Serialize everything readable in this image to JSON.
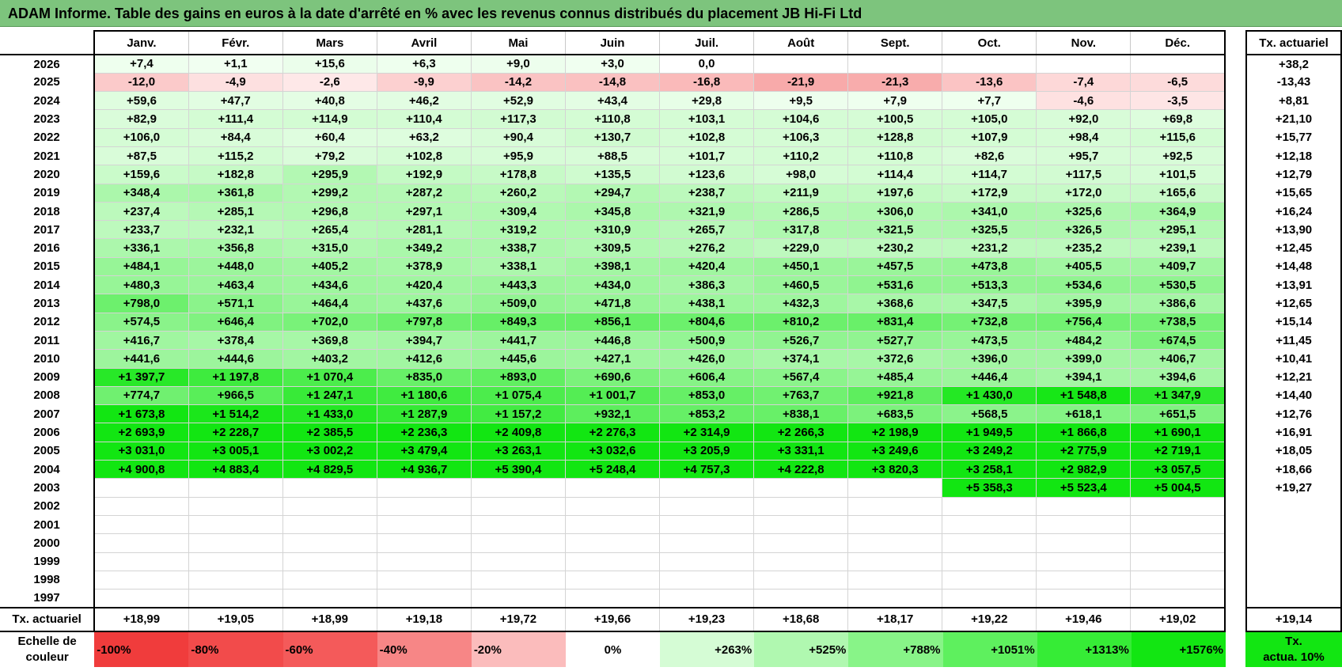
{
  "title": "ADAM Informe. Table des gains en euros à la date d'arrêté en % avec les revenus connus distribués du placement JB Hi-Fi Ltd",
  "months": [
    "Janv.",
    "Févr.",
    "Mars",
    "Avril",
    "Mai",
    "Juin",
    "Juil.",
    "Août",
    "Sept.",
    "Oct.",
    "Nov.",
    "Déc."
  ],
  "side_header": "Tx. actuariel",
  "rows": [
    {
      "year": "2026",
      "values": [
        "+7,4",
        "+1,1",
        "+15,6",
        "+6,3",
        "+9,0",
        "+3,0",
        "0,0",
        "",
        "",
        "",
        "",
        ""
      ],
      "rate": "+38,2"
    },
    {
      "year": "2025",
      "values": [
        "-12,0",
        "-4,9",
        "-2,6",
        "-9,9",
        "-14,2",
        "-14,8",
        "-16,8",
        "-21,9",
        "-21,3",
        "-13,6",
        "-7,4",
        "-6,5"
      ],
      "rate": "-13,43"
    },
    {
      "year": "2024",
      "values": [
        "+59,6",
        "+47,7",
        "+40,8",
        "+46,2",
        "+52,9",
        "+43,4",
        "+29,8",
        "+9,5",
        "+7,9",
        "+7,7",
        "-4,6",
        "-3,5"
      ],
      "rate": "+8,81"
    },
    {
      "year": "2023",
      "values": [
        "+82,9",
        "+111,4",
        "+114,9",
        "+110,4",
        "+117,3",
        "+110,8",
        "+103,1",
        "+104,6",
        "+100,5",
        "+105,0",
        "+92,0",
        "+69,8"
      ],
      "rate": "+21,10"
    },
    {
      "year": "2022",
      "values": [
        "+106,0",
        "+84,4",
        "+60,4",
        "+63,2",
        "+90,4",
        "+130,7",
        "+102,8",
        "+106,3",
        "+128,8",
        "+107,9",
        "+98,4",
        "+115,6"
      ],
      "rate": "+15,77"
    },
    {
      "year": "2021",
      "values": [
        "+87,5",
        "+115,2",
        "+79,2",
        "+102,8",
        "+95,9",
        "+88,5",
        "+101,7",
        "+110,2",
        "+110,8",
        "+82,6",
        "+95,7",
        "+92,5"
      ],
      "rate": "+12,18"
    },
    {
      "year": "2020",
      "values": [
        "+159,6",
        "+182,8",
        "+295,9",
        "+192,9",
        "+178,8",
        "+135,5",
        "+123,6",
        "+98,0",
        "+114,4",
        "+114,7",
        "+117,5",
        "+101,5"
      ],
      "rate": "+12,79"
    },
    {
      "year": "2019",
      "values": [
        "+348,4",
        "+361,8",
        "+299,2",
        "+287,2",
        "+260,2",
        "+294,7",
        "+238,7",
        "+211,9",
        "+197,6",
        "+172,9",
        "+172,0",
        "+165,6"
      ],
      "rate": "+15,65"
    },
    {
      "year": "2018",
      "values": [
        "+237,4",
        "+285,1",
        "+296,8",
        "+297,1",
        "+309,4",
        "+345,8",
        "+321,9",
        "+286,5",
        "+306,0",
        "+341,0",
        "+325,6",
        "+364,9"
      ],
      "rate": "+16,24"
    },
    {
      "year": "2017",
      "values": [
        "+233,7",
        "+232,1",
        "+265,4",
        "+281,1",
        "+319,2",
        "+310,9",
        "+265,7",
        "+317,8",
        "+321,5",
        "+325,5",
        "+326,5",
        "+295,1"
      ],
      "rate": "+13,90"
    },
    {
      "year": "2016",
      "values": [
        "+336,1",
        "+356,8",
        "+315,0",
        "+349,2",
        "+338,7",
        "+309,5",
        "+276,2",
        "+229,0",
        "+230,2",
        "+231,2",
        "+235,2",
        "+239,1"
      ],
      "rate": "+12,45"
    },
    {
      "year": "2015",
      "values": [
        "+484,1",
        "+448,0",
        "+405,2",
        "+378,9",
        "+338,1",
        "+398,1",
        "+420,4",
        "+450,1",
        "+457,5",
        "+473,8",
        "+405,5",
        "+409,7"
      ],
      "rate": "+14,48"
    },
    {
      "year": "2014",
      "values": [
        "+480,3",
        "+463,4",
        "+434,6",
        "+420,4",
        "+443,3",
        "+434,0",
        "+386,3",
        "+460,5",
        "+531,6",
        "+513,3",
        "+534,6",
        "+530,5"
      ],
      "rate": "+13,91"
    },
    {
      "year": "2013",
      "values": [
        "+798,0",
        "+571,1",
        "+464,4",
        "+437,6",
        "+509,0",
        "+471,8",
        "+438,1",
        "+432,3",
        "+368,6",
        "+347,5",
        "+395,9",
        "+386,6"
      ],
      "rate": "+12,65"
    },
    {
      "year": "2012",
      "values": [
        "+574,5",
        "+646,4",
        "+702,0",
        "+797,8",
        "+849,3",
        "+856,1",
        "+804,6",
        "+810,2",
        "+831,4",
        "+732,8",
        "+756,4",
        "+738,5"
      ],
      "rate": "+15,14"
    },
    {
      "year": "2011",
      "values": [
        "+416,7",
        "+378,4",
        "+369,8",
        "+394,7",
        "+441,7",
        "+446,8",
        "+500,9",
        "+526,7",
        "+527,7",
        "+473,5",
        "+484,2",
        "+674,5"
      ],
      "rate": "+11,45"
    },
    {
      "year": "2010",
      "values": [
        "+441,6",
        "+444,6",
        "+403,2",
        "+412,6",
        "+445,6",
        "+427,1",
        "+426,0",
        "+374,1",
        "+372,6",
        "+396,0",
        "+399,0",
        "+406,7"
      ],
      "rate": "+10,41"
    },
    {
      "year": "2009",
      "values": [
        "+1 397,7",
        "+1 197,8",
        "+1 070,4",
        "+835,0",
        "+893,0",
        "+690,6",
        "+606,4",
        "+567,4",
        "+485,4",
        "+446,4",
        "+394,1",
        "+394,6"
      ],
      "rate": "+12,21"
    },
    {
      "year": "2008",
      "values": [
        "+774,7",
        "+966,5",
        "+1 247,1",
        "+1 180,6",
        "+1 075,4",
        "+1 001,7",
        "+853,0",
        "+763,7",
        "+921,8",
        "+1 430,0",
        "+1 548,8",
        "+1 347,9"
      ],
      "rate": "+14,40"
    },
    {
      "year": "2007",
      "values": [
        "+1 673,8",
        "+1 514,2",
        "+1 433,0",
        "+1 287,9",
        "+1 157,2",
        "+932,1",
        "+853,2",
        "+838,1",
        "+683,5",
        "+568,5",
        "+618,1",
        "+651,5"
      ],
      "rate": "+12,76"
    },
    {
      "year": "2006",
      "values": [
        "+2 693,9",
        "+2 228,7",
        "+2 385,5",
        "+2 236,3",
        "+2 409,8",
        "+2 276,3",
        "+2 314,9",
        "+2 266,3",
        "+2 198,9",
        "+1 949,5",
        "+1 866,8",
        "+1 690,1"
      ],
      "rate": "+16,91"
    },
    {
      "year": "2005",
      "values": [
        "+3 031,0",
        "+3 005,1",
        "+3 002,2",
        "+3 479,4",
        "+3 263,1",
        "+3 032,6",
        "+3 205,9",
        "+3 331,1",
        "+3 249,6",
        "+3 249,2",
        "+2 775,9",
        "+2 719,1"
      ],
      "rate": "+18,05"
    },
    {
      "year": "2004",
      "values": [
        "+4 900,8",
        "+4 883,4",
        "+4 829,5",
        "+4 936,7",
        "+5 390,4",
        "+5 248,4",
        "+4 757,3",
        "+4 222,8",
        "+3 820,3",
        "+3 258,1",
        "+2 982,9",
        "+3 057,5"
      ],
      "rate": "+18,66"
    },
    {
      "year": "2003",
      "values": [
        "",
        "",
        "",
        "",
        "",
        "",
        "",
        "",
        "",
        "+5 358,3",
        "+5 523,4",
        "+5 004,5"
      ],
      "rate": "+19,27"
    },
    {
      "year": "2002",
      "values": [
        "",
        "",
        "",
        "",
        "",
        "",
        "",
        "",
        "",
        "",
        "",
        ""
      ],
      "rate": ""
    },
    {
      "year": "2001",
      "values": [
        "",
        "",
        "",
        "",
        "",
        "",
        "",
        "",
        "",
        "",
        "",
        ""
      ],
      "rate": ""
    },
    {
      "year": "2000",
      "values": [
        "",
        "",
        "",
        "",
        "",
        "",
        "",
        "",
        "",
        "",
        "",
        ""
      ],
      "rate": ""
    },
    {
      "year": "1999",
      "values": [
        "",
        "",
        "",
        "",
        "",
        "",
        "",
        "",
        "",
        "",
        "",
        ""
      ],
      "rate": ""
    },
    {
      "year": "1998",
      "values": [
        "",
        "",
        "",
        "",
        "",
        "",
        "",
        "",
        "",
        "",
        "",
        ""
      ],
      "rate": ""
    },
    {
      "year": "1997",
      "values": [
        "",
        "",
        "",
        "",
        "",
        "",
        "",
        "",
        "",
        "",
        "",
        ""
      ],
      "rate": ""
    }
  ],
  "footer": {
    "label": "Tx. actuariel",
    "values": [
      "+18,99",
      "+19,05",
      "+18,99",
      "+19,18",
      "+19,72",
      "+19,66",
      "+19,23",
      "+18,68",
      "+18,17",
      "+19,22",
      "+19,46",
      "+19,02"
    ],
    "total": "+19,14"
  },
  "scale": {
    "label_line1": "Echelle de",
    "label_line2": "couleur",
    "items": [
      {
        "label": "-100%",
        "color": "#f03c3c"
      },
      {
        "label": "-80%",
        "color": "#f24b4b"
      },
      {
        "label": "-60%",
        "color": "#f45a5a"
      },
      {
        "label": "-40%",
        "color": "#f78686"
      },
      {
        "label": "-20%",
        "color": "#fbbcbc"
      },
      {
        "label": "0%",
        "color": "#ffffff"
      },
      {
        "label": "+263%",
        "color": "#d5fcd5"
      },
      {
        "label": "+525%",
        "color": "#b0f8b0"
      },
      {
        "label": "+788%",
        "color": "#88f488"
      },
      {
        "label": "+1051%",
        "color": "#5ef05e"
      },
      {
        "label": "+1313%",
        "color": "#36ec36"
      },
      {
        "label": "+1576%",
        "color": "#12e612"
      }
    ],
    "side_line1": "Tx.",
    "side_line2": "actua. 10%",
    "side_color": "#12e612"
  }
}
